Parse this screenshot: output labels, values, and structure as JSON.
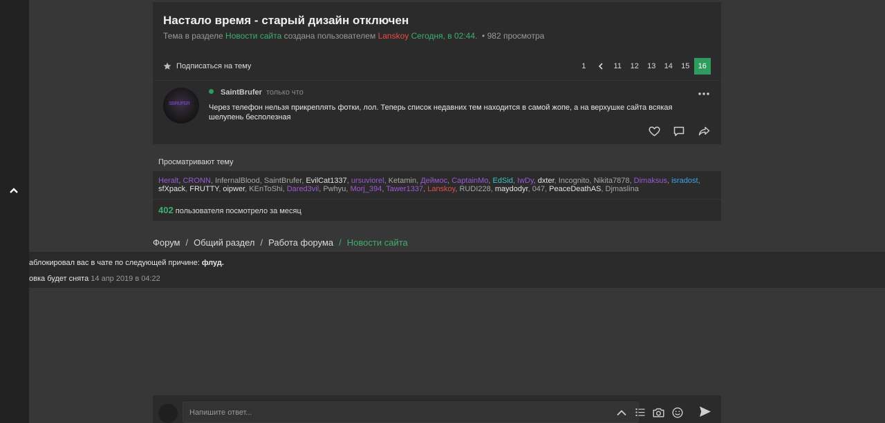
{
  "thread": {
    "title": "Настало время - старый дизайн отключен",
    "meta_prefix": "Тема в разделе",
    "section": "Новости сайта",
    "meta_created": "создана пользователем",
    "author": "Lanskoy",
    "date": "Сегодня, в 02:44.",
    "views": "982 просмотра"
  },
  "subscribe_label": "Подписаться на тему",
  "pagination": [
    "1",
    "11",
    "12",
    "13",
    "14",
    "15",
    "16"
  ],
  "pagination_active": "16",
  "post": {
    "author": "SaintBrufer",
    "time": "только что",
    "text": "Через телефон нельзя прикреплять фотки, лол. Теперь список недавних тем находится в самой жопе, а на верхушке сайта всякая шелупень бесполезная",
    "avatar_logo": "SBRUFER"
  },
  "viewers": {
    "label": "Просматривают тему",
    "users": [
      {
        "name": "Heralt",
        "color": "purple"
      },
      {
        "name": "CRONN",
        "color": "purple"
      },
      {
        "name": "InfernalBlood",
        "color": "grey"
      },
      {
        "name": "SaintBrufer",
        "color": "grey"
      },
      {
        "name": "EvilCat1337",
        "color": "white"
      },
      {
        "name": "ursuviorel",
        "color": "purple"
      },
      {
        "name": "Ketamin",
        "color": "grey"
      },
      {
        "name": "Деймос",
        "color": "purple"
      },
      {
        "name": "CaptainMo",
        "color": "purple"
      },
      {
        "name": "EdSid",
        "color": "cyan"
      },
      {
        "name": "IwDy",
        "color": "purple"
      },
      {
        "name": "dxter",
        "color": "white"
      },
      {
        "name": "Incognito",
        "color": "grey"
      },
      {
        "name": "Nikita7878",
        "color": "grey"
      },
      {
        "name": "Dimaksus",
        "color": "purple"
      },
      {
        "name": "isradost",
        "color": "blue"
      },
      {
        "name": "sfXpack",
        "color": "white"
      },
      {
        "name": "FRUTTY",
        "color": "white"
      },
      {
        "name": "oipwer",
        "color": "white"
      },
      {
        "name": "KEnToShi",
        "color": "grey"
      },
      {
        "name": "Dared3vil",
        "color": "purple"
      },
      {
        "name": "Pwhyu",
        "color": "grey"
      },
      {
        "name": "Morj_394",
        "color": "purple"
      },
      {
        "name": "Tawer1337",
        "color": "purple"
      },
      {
        "name": "Lanskoy",
        "color": "red"
      },
      {
        "name": "RUDI228",
        "color": "grey"
      },
      {
        "name": "maydodyr",
        "color": "white"
      },
      {
        "name": "047",
        "color": "grey"
      },
      {
        "name": "PeaceDeathAS",
        "color": "white"
      },
      {
        "name": "Djmaslina",
        "color": "grey"
      }
    ],
    "month_count": "402",
    "month_label": "пользователя посмотрело за месяц"
  },
  "breadcrumb": [
    "Форум",
    "Общий раздел",
    "Работа форума",
    "Новости сайта"
  ],
  "ban": {
    "line1_text": "аблокировал вас в чате по следующей причине:",
    "reason": "флуд.",
    "line2_text": "овка будет снята",
    "until": "14 апр 2019 в 04:22"
  },
  "reply": {
    "placeholder": "Напишите ответ..."
  },
  "colors": {
    "accent_green": "#2e9c5f",
    "author_red": "#e84a4a",
    "purple": "#9b59d6",
    "cyan": "#3fc4c4",
    "blue": "#3ea4e8"
  }
}
